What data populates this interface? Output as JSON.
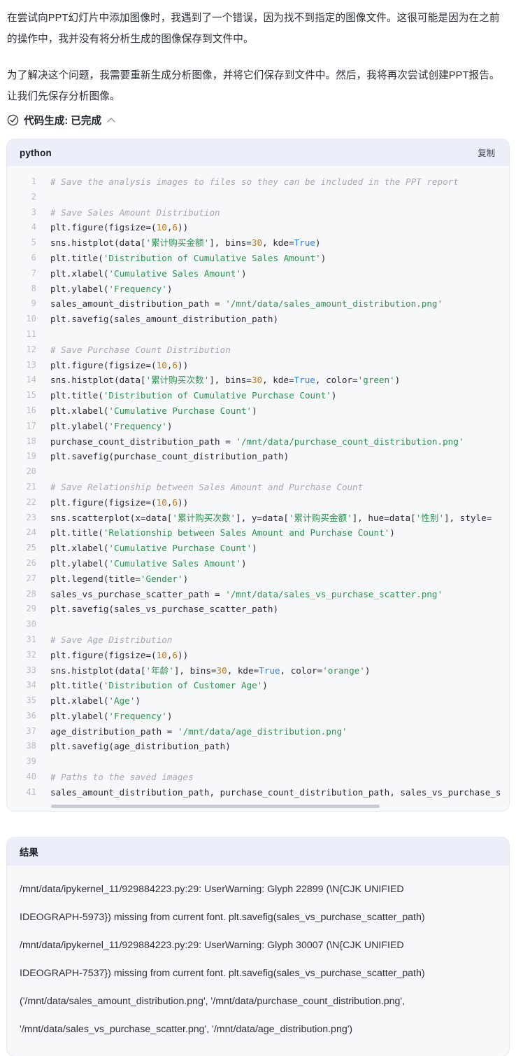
{
  "intro": {
    "paragraph_1": "在尝试向PPT幻灯片中添加图像时，我遇到了一个错误，因为找不到指定的图像文件。这很可能是因为在之前的操作中，我并没有将分析生成的图像保存到文件中。",
    "paragraph_2": "为了解决这个问题，我需要重新生成分析图像，并将它们保存到文件中。然后，我将再次尝试创建PPT报告。让我们先保存分析图像。"
  },
  "status": {
    "label": "代码生成: 已完成",
    "icon": "check-circle-icon",
    "toggle_icon": "chevron-up-icon"
  },
  "code_card": {
    "language": "python",
    "copy_label": "复制",
    "lines": [
      {
        "n": "1",
        "tokens": [
          {
            "t": "# Save the analysis images to files so they can be included in the PPT report",
            "c": "cm"
          }
        ]
      },
      {
        "n": "2",
        "tokens": []
      },
      {
        "n": "3",
        "tokens": [
          {
            "t": "# Save Sales Amount Distribution",
            "c": "cm"
          }
        ]
      },
      {
        "n": "4",
        "tokens": [
          {
            "t": "plt.figure(figsize=(",
            "c": "code-txt"
          },
          {
            "t": "10",
            "c": "nu"
          },
          {
            "t": ",",
            "c": "code-txt"
          },
          {
            "t": "6",
            "c": "nu"
          },
          {
            "t": "))",
            "c": "code-txt"
          }
        ]
      },
      {
        "n": "5",
        "tokens": [
          {
            "t": "sns.histplot(data[",
            "c": "code-txt"
          },
          {
            "t": "'累计购买金额'",
            "c": "st"
          },
          {
            "t": "], bins=",
            "c": "code-txt"
          },
          {
            "t": "30",
            "c": "nu"
          },
          {
            "t": ", kde=",
            "c": "code-txt"
          },
          {
            "t": "True",
            "c": "kw"
          },
          {
            "t": ")",
            "c": "code-txt"
          }
        ]
      },
      {
        "n": "6",
        "tokens": [
          {
            "t": "plt.title(",
            "c": "code-txt"
          },
          {
            "t": "'Distribution of Cumulative Sales Amount'",
            "c": "st"
          },
          {
            "t": ")",
            "c": "code-txt"
          }
        ]
      },
      {
        "n": "7",
        "tokens": [
          {
            "t": "plt.xlabel(",
            "c": "code-txt"
          },
          {
            "t": "'Cumulative Sales Amount'",
            "c": "st"
          },
          {
            "t": ")",
            "c": "code-txt"
          }
        ]
      },
      {
        "n": "8",
        "tokens": [
          {
            "t": "plt.ylabel(",
            "c": "code-txt"
          },
          {
            "t": "'Frequency'",
            "c": "st"
          },
          {
            "t": ")",
            "c": "code-txt"
          }
        ]
      },
      {
        "n": "9",
        "tokens": [
          {
            "t": "sales_amount_distribution_path = ",
            "c": "code-txt"
          },
          {
            "t": "'/mnt/data/sales_amount_distribution.png'",
            "c": "st"
          }
        ]
      },
      {
        "n": "10",
        "tokens": [
          {
            "t": "plt.savefig(sales_amount_distribution_path)",
            "c": "code-txt"
          }
        ]
      },
      {
        "n": "11",
        "tokens": []
      },
      {
        "n": "12",
        "tokens": [
          {
            "t": "# Save Purchase Count Distribution",
            "c": "cm"
          }
        ]
      },
      {
        "n": "13",
        "tokens": [
          {
            "t": "plt.figure(figsize=(",
            "c": "code-txt"
          },
          {
            "t": "10",
            "c": "nu"
          },
          {
            "t": ",",
            "c": "code-txt"
          },
          {
            "t": "6",
            "c": "nu"
          },
          {
            "t": "))",
            "c": "code-txt"
          }
        ]
      },
      {
        "n": "14",
        "tokens": [
          {
            "t": "sns.histplot(data[",
            "c": "code-txt"
          },
          {
            "t": "'累计购买次数'",
            "c": "st"
          },
          {
            "t": "], bins=",
            "c": "code-txt"
          },
          {
            "t": "30",
            "c": "nu"
          },
          {
            "t": ", kde=",
            "c": "code-txt"
          },
          {
            "t": "True",
            "c": "kw"
          },
          {
            "t": ", color=",
            "c": "code-txt"
          },
          {
            "t": "'green'",
            "c": "st"
          },
          {
            "t": ")",
            "c": "code-txt"
          }
        ]
      },
      {
        "n": "15",
        "tokens": [
          {
            "t": "plt.title(",
            "c": "code-txt"
          },
          {
            "t": "'Distribution of Cumulative Purchase Count'",
            "c": "st"
          },
          {
            "t": ")",
            "c": "code-txt"
          }
        ]
      },
      {
        "n": "16",
        "tokens": [
          {
            "t": "plt.xlabel(",
            "c": "code-txt"
          },
          {
            "t": "'Cumulative Purchase Count'",
            "c": "st"
          },
          {
            "t": ")",
            "c": "code-txt"
          }
        ]
      },
      {
        "n": "17",
        "tokens": [
          {
            "t": "plt.ylabel(",
            "c": "code-txt"
          },
          {
            "t": "'Frequency'",
            "c": "st"
          },
          {
            "t": ")",
            "c": "code-txt"
          }
        ]
      },
      {
        "n": "18",
        "tokens": [
          {
            "t": "purchase_count_distribution_path = ",
            "c": "code-txt"
          },
          {
            "t": "'/mnt/data/purchase_count_distribution.png'",
            "c": "st"
          }
        ]
      },
      {
        "n": "19",
        "tokens": [
          {
            "t": "plt.savefig(purchase_count_distribution_path)",
            "c": "code-txt"
          }
        ]
      },
      {
        "n": "20",
        "tokens": []
      },
      {
        "n": "21",
        "tokens": [
          {
            "t": "# Save Relationship between Sales Amount and Purchase Count",
            "c": "cm"
          }
        ]
      },
      {
        "n": "22",
        "tokens": [
          {
            "t": "plt.figure(figsize=(",
            "c": "code-txt"
          },
          {
            "t": "10",
            "c": "nu"
          },
          {
            "t": ",",
            "c": "code-txt"
          },
          {
            "t": "6",
            "c": "nu"
          },
          {
            "t": "))",
            "c": "code-txt"
          }
        ]
      },
      {
        "n": "23",
        "tokens": [
          {
            "t": "sns.scatterplot(x=data[",
            "c": "code-txt"
          },
          {
            "t": "'累计购买次数'",
            "c": "st"
          },
          {
            "t": "], y=data[",
            "c": "code-txt"
          },
          {
            "t": "'累计购买金额'",
            "c": "st"
          },
          {
            "t": "], hue=data[",
            "c": "code-txt"
          },
          {
            "t": "'性别'",
            "c": "st"
          },
          {
            "t": "], style=",
            "c": "code-txt"
          }
        ]
      },
      {
        "n": "24",
        "tokens": [
          {
            "t": "plt.title(",
            "c": "code-txt"
          },
          {
            "t": "'Relationship between Sales Amount and Purchase Count'",
            "c": "st"
          },
          {
            "t": ")",
            "c": "code-txt"
          }
        ]
      },
      {
        "n": "25",
        "tokens": [
          {
            "t": "plt.xlabel(",
            "c": "code-txt"
          },
          {
            "t": "'Cumulative Purchase Count'",
            "c": "st"
          },
          {
            "t": ")",
            "c": "code-txt"
          }
        ]
      },
      {
        "n": "26",
        "tokens": [
          {
            "t": "plt.ylabel(",
            "c": "code-txt"
          },
          {
            "t": "'Cumulative Sales Amount'",
            "c": "st"
          },
          {
            "t": ")",
            "c": "code-txt"
          }
        ]
      },
      {
        "n": "27",
        "tokens": [
          {
            "t": "plt.legend(title=",
            "c": "code-txt"
          },
          {
            "t": "'Gender'",
            "c": "st"
          },
          {
            "t": ")",
            "c": "code-txt"
          }
        ]
      },
      {
        "n": "28",
        "tokens": [
          {
            "t": "sales_vs_purchase_scatter_path = ",
            "c": "code-txt"
          },
          {
            "t": "'/mnt/data/sales_vs_purchase_scatter.png'",
            "c": "st"
          }
        ]
      },
      {
        "n": "29",
        "tokens": [
          {
            "t": "plt.savefig(sales_vs_purchase_scatter_path)",
            "c": "code-txt"
          }
        ]
      },
      {
        "n": "30",
        "tokens": []
      },
      {
        "n": "31",
        "tokens": [
          {
            "t": "# Save Age Distribution",
            "c": "cm"
          }
        ]
      },
      {
        "n": "32",
        "tokens": [
          {
            "t": "plt.figure(figsize=(",
            "c": "code-txt"
          },
          {
            "t": "10",
            "c": "nu"
          },
          {
            "t": ",",
            "c": "code-txt"
          },
          {
            "t": "6",
            "c": "nu"
          },
          {
            "t": "))",
            "c": "code-txt"
          }
        ]
      },
      {
        "n": "33",
        "tokens": [
          {
            "t": "sns.histplot(data[",
            "c": "code-txt"
          },
          {
            "t": "'年龄'",
            "c": "st"
          },
          {
            "t": "], bins=",
            "c": "code-txt"
          },
          {
            "t": "30",
            "c": "nu"
          },
          {
            "t": ", kde=",
            "c": "code-txt"
          },
          {
            "t": "True",
            "c": "kw"
          },
          {
            "t": ", color=",
            "c": "code-txt"
          },
          {
            "t": "'orange'",
            "c": "st"
          },
          {
            "t": ")",
            "c": "code-txt"
          }
        ]
      },
      {
        "n": "34",
        "tokens": [
          {
            "t": "plt.title(",
            "c": "code-txt"
          },
          {
            "t": "'Distribution of Customer Age'",
            "c": "st"
          },
          {
            "t": ")",
            "c": "code-txt"
          }
        ]
      },
      {
        "n": "35",
        "tokens": [
          {
            "t": "plt.xlabel(",
            "c": "code-txt"
          },
          {
            "t": "'Age'",
            "c": "st"
          },
          {
            "t": ")",
            "c": "code-txt"
          }
        ]
      },
      {
        "n": "36",
        "tokens": [
          {
            "t": "plt.ylabel(",
            "c": "code-txt"
          },
          {
            "t": "'Frequency'",
            "c": "st"
          },
          {
            "t": ")",
            "c": "code-txt"
          }
        ]
      },
      {
        "n": "37",
        "tokens": [
          {
            "t": "age_distribution_path = ",
            "c": "code-txt"
          },
          {
            "t": "'/mnt/data/age_distribution.png'",
            "c": "st"
          }
        ]
      },
      {
        "n": "38",
        "tokens": [
          {
            "t": "plt.savefig(age_distribution_path)",
            "c": "code-txt"
          }
        ]
      },
      {
        "n": "39",
        "tokens": []
      },
      {
        "n": "40",
        "tokens": [
          {
            "t": "# Paths to the saved images",
            "c": "cm"
          }
        ]
      },
      {
        "n": "41",
        "tokens": [
          {
            "t": "sales_amount_distribution_path, purchase_count_distribution_path, sales_vs_purchase_s",
            "c": "code-txt"
          }
        ]
      }
    ]
  },
  "result_card": {
    "title": "结果",
    "lines": [
      "/mnt/data/ipykernel_11/929884223.py:29: UserWarning: Glyph 22899 (\\N{CJK UNIFIED",
      "IDEOGRAPH-5973}) missing from current font. plt.savefig(sales_vs_purchase_scatter_path)",
      "/mnt/data/ipykernel_11/929884223.py:29: UserWarning: Glyph 30007 (\\N{CJK UNIFIED",
      "IDEOGRAPH-7537}) missing from current font. plt.savefig(sales_vs_purchase_scatter_path)",
      "('/mnt/data/sales_amount_distribution.png', '/mnt/data/purchase_count_distribution.png',",
      "'/mnt/data/sales_vs_purchase_scatter.png', '/mnt/data/age_distribution.png')"
    ]
  },
  "colors": {
    "card_header_bg": "#eceefa",
    "card_body_bg": "#f7f8fa",
    "string_token": "#2f9052",
    "number_token": "#c47710",
    "keyword_token": "#2f7fe0",
    "comment_token": "#a3a8b2",
    "text": "#2b2f38"
  }
}
